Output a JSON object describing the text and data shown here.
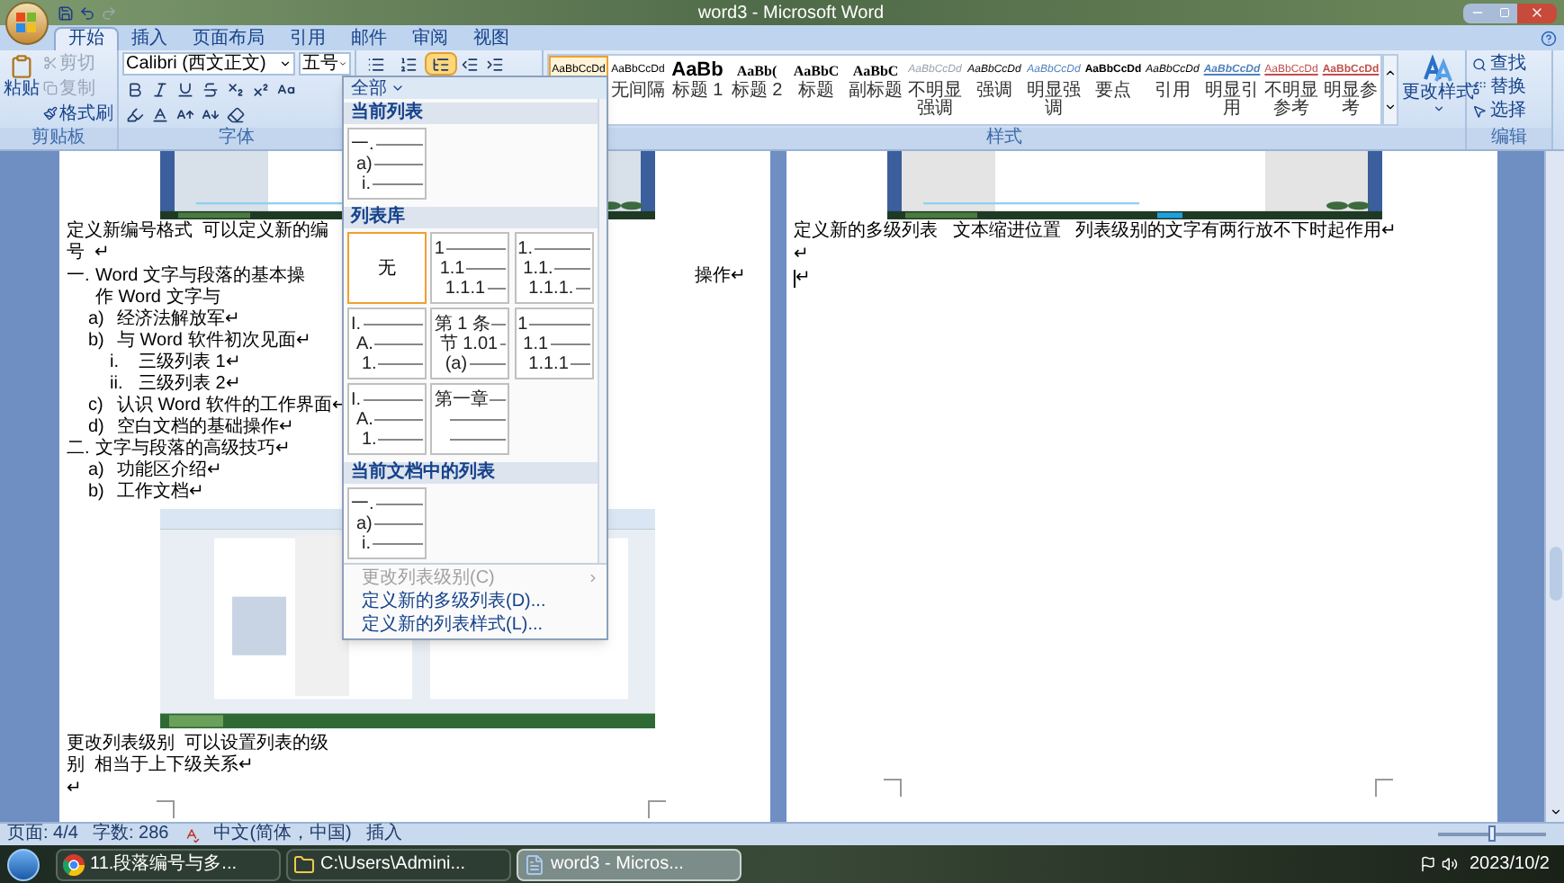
{
  "window": {
    "title": "word3 - Microsoft Word"
  },
  "tabs": [
    {
      "label": "开始",
      "selected": true
    },
    {
      "label": "插入",
      "selected": false
    },
    {
      "label": "页面布局",
      "selected": false
    },
    {
      "label": "引用",
      "selected": false
    },
    {
      "label": "邮件",
      "selected": false
    },
    {
      "label": "审阅",
      "selected": false
    },
    {
      "label": "视图",
      "selected": false
    }
  ],
  "ribbon": {
    "clipboard": {
      "label": "剪贴板",
      "paste": "粘贴",
      "items": [
        {
          "label": "剪切",
          "disabled": true
        },
        {
          "label": "复制",
          "disabled": true
        },
        {
          "label": "格式刷",
          "disabled": false
        }
      ]
    },
    "font": {
      "label": "字体",
      "font_name": "Calibri (西文正文)",
      "font_size": "五号"
    },
    "paragraph": {
      "multilevel_open": true
    },
    "styles": {
      "label": "样式",
      "change_styles": "更改样式",
      "items": [
        {
          "preview": "AaBbCcDd",
          "kind": "normal",
          "selected": true
        },
        {
          "preview": "AaBbCcDd",
          "label": "无间隔",
          "kind": "normal",
          "selected": false
        },
        {
          "preview": "AaBb",
          "label": "标题 1",
          "kind": "heading1",
          "selected": false
        },
        {
          "preview": "AaBb(",
          "label": "标题 2",
          "kind": "heading2",
          "selected": false
        },
        {
          "preview": "AaBbC",
          "label": "标题",
          "kind": "title",
          "selected": false
        },
        {
          "preview": "AaBbC",
          "label": "副标题",
          "kind": "title",
          "selected": false
        },
        {
          "preview": "AaBbCcDd",
          "label": "不明显强调",
          "kind": "subtle-emphasis",
          "selected": false
        },
        {
          "preview": "AaBbCcDd",
          "label": "强调",
          "kind": "emphasis",
          "selected": false
        },
        {
          "preview": "AaBbCcDd",
          "label": "明显强调",
          "kind": "intense-emphasis",
          "selected": false
        },
        {
          "preview": "AaBbCcDd",
          "label": "要点",
          "kind": "strong",
          "selected": false
        },
        {
          "preview": "AaBbCcDd",
          "label": "引用",
          "kind": "emphasis",
          "selected": false
        },
        {
          "preview": "AaBbCcDd",
          "label": "明显引用",
          "kind": "intense-quote",
          "selected": false
        },
        {
          "preview": "AaBbCcDd",
          "label": "不明显参考",
          "kind": "subtle-reference",
          "selected": false
        },
        {
          "preview": "AaBbCcDd",
          "label": "明显参考",
          "kind": "intense-reference",
          "selected": false
        }
      ]
    },
    "editing": {
      "label": "编辑",
      "items": [
        {
          "label": "查找",
          "kind": "find"
        },
        {
          "label": "替换",
          "kind": "replace"
        },
        {
          "label": "选择",
          "kind": "select"
        }
      ]
    }
  },
  "multilevel_menu": {
    "filter": "全部",
    "sections": [
      {
        "title": "当前列表",
        "lists": [
          {
            "kind": "preview",
            "selected": false,
            "levels": [
              "一.",
              "a)",
              "i."
            ]
          }
        ]
      },
      {
        "title": "列表库",
        "lists": [
          {
            "kind": "none",
            "label": "无",
            "selected": true
          },
          {
            "kind": "preview",
            "selected": false,
            "levels": [
              "1",
              "1.1",
              "1.1.1"
            ]
          },
          {
            "kind": "preview",
            "selected": false,
            "levels": [
              "1.",
              "1.1.",
              "1.1.1."
            ]
          },
          {
            "kind": "preview",
            "selected": false,
            "levels": [
              "I.",
              "A.",
              "1."
            ]
          },
          {
            "kind": "preview",
            "selected": false,
            "levels": [
              "第 1 条",
              "节 1.01",
              "(a)"
            ]
          },
          {
            "kind": "preview",
            "selected": false,
            "levels": [
              "1",
              "1.1",
              "1.1.1"
            ]
          },
          {
            "kind": "preview",
            "selected": false,
            "levels": [
              "I.",
              "A.",
              "1."
            ]
          },
          {
            "kind": "preview",
            "selected": false,
            "levels": [
              "第一章"
            ]
          }
        ]
      },
      {
        "title": "当前文档中的列表",
        "lists": [
          {
            "kind": "preview",
            "selected": false,
            "levels": [
              "一.",
              "a)",
              "i."
            ]
          }
        ]
      }
    ],
    "commands": [
      {
        "label": "更改列表级别(C)",
        "disabled": true,
        "submenu": true
      },
      {
        "label": "定义新的多级列表(D)...",
        "disabled": false,
        "submenu": false
      },
      {
        "label": "定义新的列表样式(L)...",
        "disabled": false,
        "submenu": false
      }
    ]
  },
  "pages": [
    {
      "blocks": [
        {
          "kind": "picture"
        },
        {
          "kind": "text",
          "text": "定义新编号格式  可以定义新的编号  ↵"
        },
        {
          "kind": "list",
          "items": [
            {
              "marker": "一.",
              "text": "Word 文字与段落的基本操作 Word 文字与",
              "tail": "操作↵",
              "children": [
                {
                  "marker": "a)",
                  "text": "经济法解放军↵"
                },
                {
                  "marker": "b)",
                  "text": "与 Word 软件初次见面↵",
                  "children": [
                    {
                      "marker": "i.",
                      "text": "三级列表 1↵"
                    },
                    {
                      "marker": "ii.",
                      "text": "三级列表 2↵"
                    }
                  ]
                },
                {
                  "marker": "c)",
                  "text": "认识 Word 软件的工作界面↵"
                },
                {
                  "marker": "d)",
                  "text": "空白文档的基础操作↵"
                }
              ]
            },
            {
              "marker": "二.",
              "text": "文字与段落的高级技巧↵",
              "children": [
                {
                  "marker": "a)",
                  "text": "功能区介绍↵"
                },
                {
                  "marker": "b)",
                  "text": "工作文档↵"
                }
              ]
            }
          ]
        },
        {
          "kind": "screenshot"
        },
        {
          "kind": "text",
          "text": "更改列表级别  可以设置列表的级别  相当于上下级关系↵"
        },
        {
          "kind": "text",
          "text": "↵"
        }
      ]
    },
    {
      "blocks": [
        {
          "kind": "picture"
        },
        {
          "kind": "text",
          "text": "定义新的多级列表   文本缩进位置   列表级别的文字有两行放不下时起作用↵"
        },
        {
          "kind": "text",
          "text": "↵"
        },
        {
          "kind": "cursor",
          "text": "↵"
        }
      ]
    }
  ],
  "status_bar": {
    "items": [
      "页面: 4/4",
      "字数: 286",
      "中文(简体，中国)",
      "插入"
    ],
    "zoom": {
      "level": 0.5
    }
  },
  "taskbar": {
    "buttons": [
      {
        "label": "11.段落编号与多...",
        "kind": "browser",
        "selected": false
      },
      {
        "label": "C:\\Users\\Admini...",
        "kind": "folder",
        "selected": false
      },
      {
        "label": "word3 - Micros...",
        "kind": "document",
        "selected": true
      }
    ],
    "date": "2023/10/2"
  }
}
